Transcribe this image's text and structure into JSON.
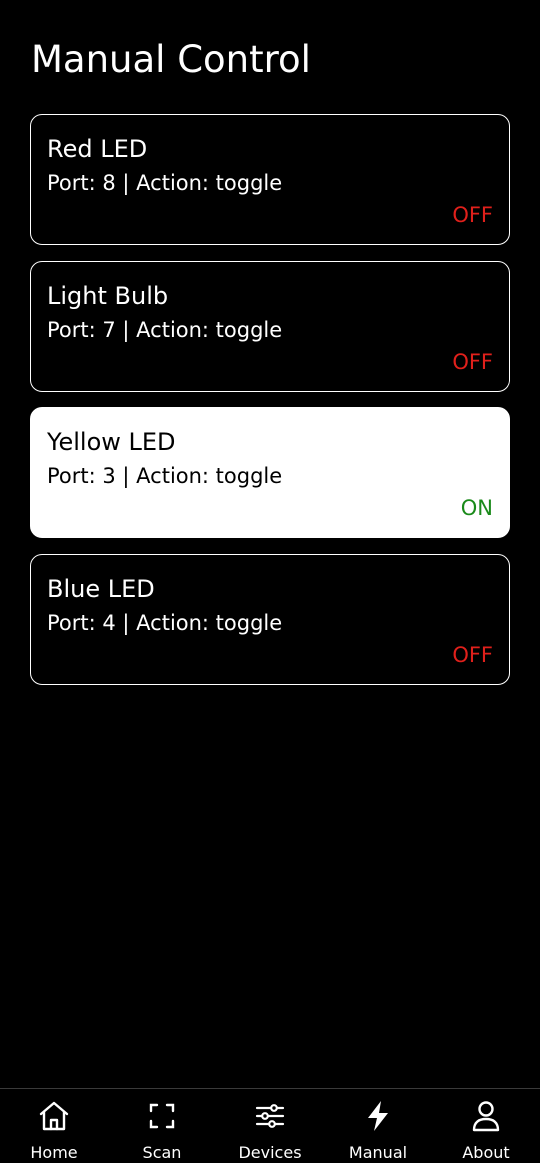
{
  "header": {
    "title": "Manual Control"
  },
  "devices": [
    {
      "name": "Red LED",
      "meta": "Port: 8 | Action: toggle",
      "state": "OFF",
      "on": false
    },
    {
      "name": "Light Bulb",
      "meta": "Port: 7 | Action: toggle",
      "state": "OFF",
      "on": false
    },
    {
      "name": "Yellow LED",
      "meta": "Port: 3 | Action: toggle",
      "state": "ON",
      "on": true
    },
    {
      "name": "Blue LED",
      "meta": "Port: 4 | Action: toggle",
      "state": "OFF",
      "on": false
    }
  ],
  "colors": {
    "background": "#000000",
    "card_border": "#ffffff",
    "card_on_background": "#ffffff",
    "state_off": "#e0201b",
    "state_on": "#1a8a1a"
  },
  "nav": {
    "items": [
      {
        "label": "Home",
        "icon": "home-icon"
      },
      {
        "label": "Scan",
        "icon": "scan-icon"
      },
      {
        "label": "Devices",
        "icon": "sliders-icon"
      },
      {
        "label": "Manual",
        "icon": "lightning-icon"
      },
      {
        "label": "About",
        "icon": "user-icon"
      }
    ]
  }
}
